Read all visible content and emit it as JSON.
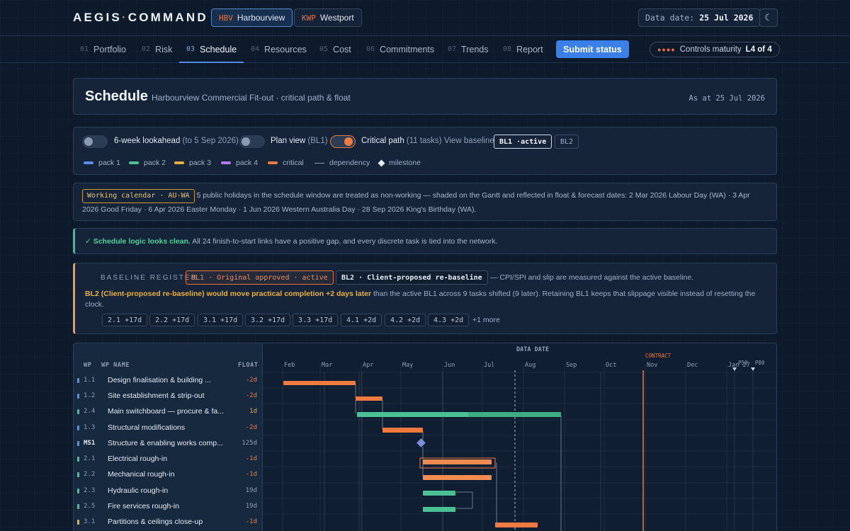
{
  "brand": {
    "left": "AEGIS",
    "sep": "·",
    "right": "COMMAND"
  },
  "projects": [
    {
      "code": "HBV",
      "name": "Harbourview",
      "active": true
    },
    {
      "code": "KWP",
      "name": "Westport",
      "active": false
    }
  ],
  "data_date": {
    "label": "Data date:",
    "value": "25 Jul 2026"
  },
  "theme_icon": "☾",
  "nav": {
    "tabs": [
      {
        "num": "01",
        "label": "Portfolio"
      },
      {
        "num": "02",
        "label": "Risk"
      },
      {
        "num": "03",
        "label": "Schedule",
        "active": true
      },
      {
        "num": "04",
        "label": "Resources"
      },
      {
        "num": "05",
        "label": "Cost"
      },
      {
        "num": "06",
        "label": "Commitments"
      },
      {
        "num": "07",
        "label": "Trends"
      },
      {
        "num": "08",
        "label": "Report"
      }
    ],
    "submit_label": "Submit status",
    "maturity": {
      "dots": "●●●●",
      "label": "Controls maturity",
      "value": "L4 of 4"
    }
  },
  "header": {
    "title": "Schedule",
    "subtitle": "Harbourview Commercial Fit-out · critical path & float",
    "as_at": "As at 25 Jul 2026"
  },
  "controls": {
    "lookahead": {
      "label": "6-week lookahead",
      "detail": "(to 5 Sep 2026)",
      "on": false
    },
    "plan_view": {
      "label": "Plan view",
      "detail": "(BL1)",
      "on": false
    },
    "critical_path": {
      "label": "Critical path",
      "detail": "(11 tasks)",
      "on": true
    },
    "view_baseline_label": "View baseline",
    "baselines": [
      {
        "label": "BL1 ·active",
        "active": true
      },
      {
        "label": "BL2",
        "active": false
      }
    ],
    "legend": [
      {
        "label": "pack 1",
        "color": "#5b8def"
      },
      {
        "label": "pack 2",
        "color": "#4cc196"
      },
      {
        "label": "pack 3",
        "color": "#e8b040"
      },
      {
        "label": "pack 4",
        "color": "#b57be8"
      },
      {
        "label": "critical",
        "color": "#f07a40"
      },
      {
        "label": "dependency",
        "color": "#8896a8"
      },
      {
        "label": "milestone",
        "color": "#e6ecf3"
      }
    ]
  },
  "calendar": {
    "badge": "Working calendar · AU-WA",
    "text": "5 public holidays in the schedule window are treated as non-working — shaded on the Gantt and reflected in float & forecast dates: 2 Mar 2026 Labour Day (WA) · 3 Apr 2026 Good Friday · 6 Apr 2026 Easter Monday · 1 Jun 2026 Western Australia Day · 28 Sep 2026 King's Birthday (WA)."
  },
  "logic": {
    "ok": "✓ Schedule logic looks clean.",
    "text": "All 24 finish-to-start links have a positive gap, and every discrete task is tied into the network."
  },
  "baseline_register": {
    "label": "BASELINE REGISTER",
    "bl1": "BL1 · Original approved · active",
    "bl2": "BL2 · Client-proposed re-baseline",
    "note": "— CPI/SPI and slip are measured against the active baseline.",
    "warn": "BL2 (Client-proposed re-baseline) would move practical completion +2 days later",
    "message": "than the active BL1 across 9 tasks shifted (9 later). Retaining BL1 keeps that slippage visible instead of resetting the clock.",
    "chips": [
      "2.1 +17d",
      "2.2 +17d",
      "3.1 +17d",
      "3.2 +17d",
      "3.3 +17d",
      "4.1 +2d",
      "4.2 +2d",
      "4.3 +2d"
    ],
    "more": "+1 more"
  },
  "gantt": {
    "headers": {
      "wp": "WP",
      "name": "WP NAME",
      "float": "FLOAT"
    },
    "data_date_label": "DATA DATE",
    "contract_label": "CONTRACT",
    "p50_label": "P50",
    "p80_label": "P80",
    "months": [
      "Feb",
      "Mar",
      "Apr",
      "May",
      "Jun",
      "Jul",
      "Aug",
      "Sep",
      "Oct",
      "Nov",
      "Dec",
      "Jan 27"
    ],
    "tasks": [
      {
        "wp": "1.1",
        "name": "Design finalisation & building ...",
        "float": "-2d",
        "pack": 1
      },
      {
        "wp": "1.2",
        "name": "Site establishment & strip-out",
        "float": "-2d",
        "pack": 1
      },
      {
        "wp": "2.4",
        "name": "Main switchboard — procure & fa...",
        "float": "1d",
        "pack": 2
      },
      {
        "wp": "1.3",
        "name": "Structural modifications",
        "float": "-2d",
        "pack": 1
      },
      {
        "wp": "MS1",
        "name": "Structure & enabling works comp...",
        "float": "125d",
        "pack": 1
      },
      {
        "wp": "2.1",
        "name": "Electrical rough-in",
        "float": "-1d",
        "pack": 2
      },
      {
        "wp": "2.2",
        "name": "Mechanical rough-in",
        "float": "-1d",
        "pack": 2
      },
      {
        "wp": "2.3",
        "name": "Hydraulic rough-in",
        "float": "19d",
        "pack": 2
      },
      {
        "wp": "2.5",
        "name": "Fire services rough-in",
        "float": "19d",
        "pack": 2
      },
      {
        "wp": "3.1",
        "name": "Partitions & ceilings close-up",
        "float": "-1d",
        "pack": 3
      }
    ]
  }
}
